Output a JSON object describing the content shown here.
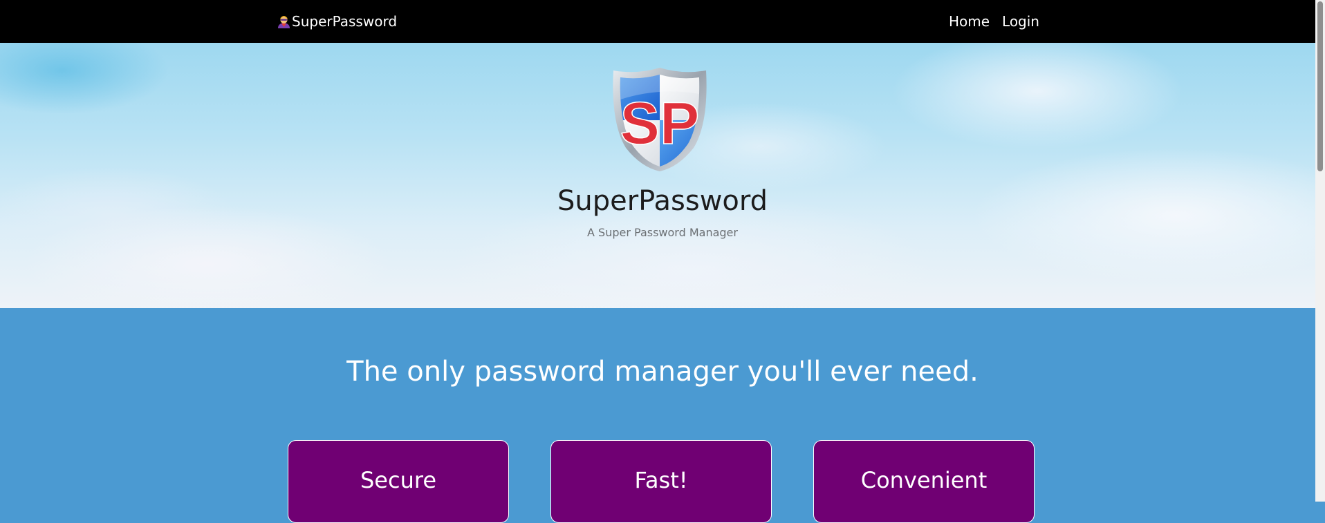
{
  "navbar": {
    "brand_label": "SuperPassword",
    "brand_icon": "superhero-emoji-icon",
    "links": [
      {
        "label": "Home"
      },
      {
        "label": "Login"
      }
    ]
  },
  "hero": {
    "logo_icon": "sp-shield-logo",
    "title": "SuperPassword",
    "subtitle": "A Super Password Manager"
  },
  "features": {
    "tagline": "The only password manager you'll ever need.",
    "cards": [
      {
        "label": "Secure"
      },
      {
        "label": "Fast!"
      },
      {
        "label": "Convenient"
      }
    ]
  },
  "colors": {
    "navbar_bg": "#000000",
    "section_bg": "#4b9ad2",
    "card_bg": "#700073",
    "logo_red": "#e0303a",
    "logo_blue": "#1e6fd8"
  }
}
